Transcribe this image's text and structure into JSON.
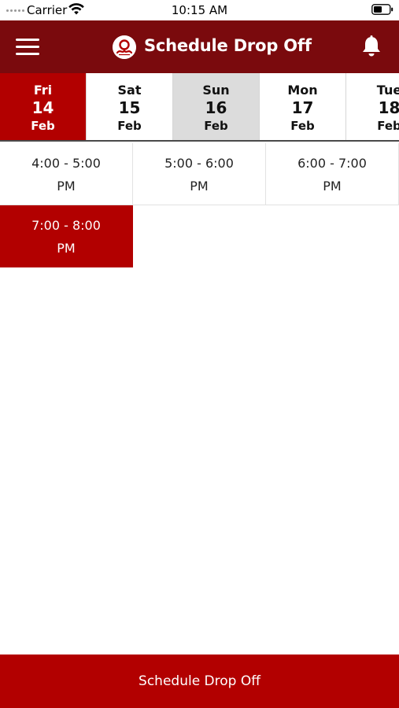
{
  "status_bar": {
    "carrier": "Carrier",
    "time": "10:15 AM"
  },
  "header": {
    "title": "Schedule Drop Off",
    "menu_icon": "hamburger-menu-icon",
    "logo_icon": "brand-logo-icon",
    "bell_icon": "notification-bell-icon",
    "background_color": "#7a0a0d"
  },
  "dates": [
    {
      "dow": "Fri",
      "day": "14",
      "month": "Feb",
      "state": "selected"
    },
    {
      "dow": "Sat",
      "day": "15",
      "month": "Feb",
      "state": "normal"
    },
    {
      "dow": "Sun",
      "day": "16",
      "month": "Feb",
      "state": "today"
    },
    {
      "dow": "Mon",
      "day": "17",
      "month": "Feb",
      "state": "normal"
    },
    {
      "dow": "Tue",
      "day": "18",
      "month": "Feb",
      "state": "normal"
    }
  ],
  "slots": [
    {
      "range": "4:00  - 5:00",
      "period": "PM",
      "selected": false
    },
    {
      "range": "5:00  - 6:00",
      "period": "PM",
      "selected": false
    },
    {
      "range": "6:00  - 7:00",
      "period": "PM",
      "selected": false
    },
    {
      "range": "7:00  - 8:00",
      "period": "PM",
      "selected": true
    }
  ],
  "footer": {
    "button_label": "Schedule Drop Off"
  },
  "colors": {
    "accent": "#b20000",
    "header": "#7a0a0d",
    "today_highlight": "#dcdcdc"
  }
}
